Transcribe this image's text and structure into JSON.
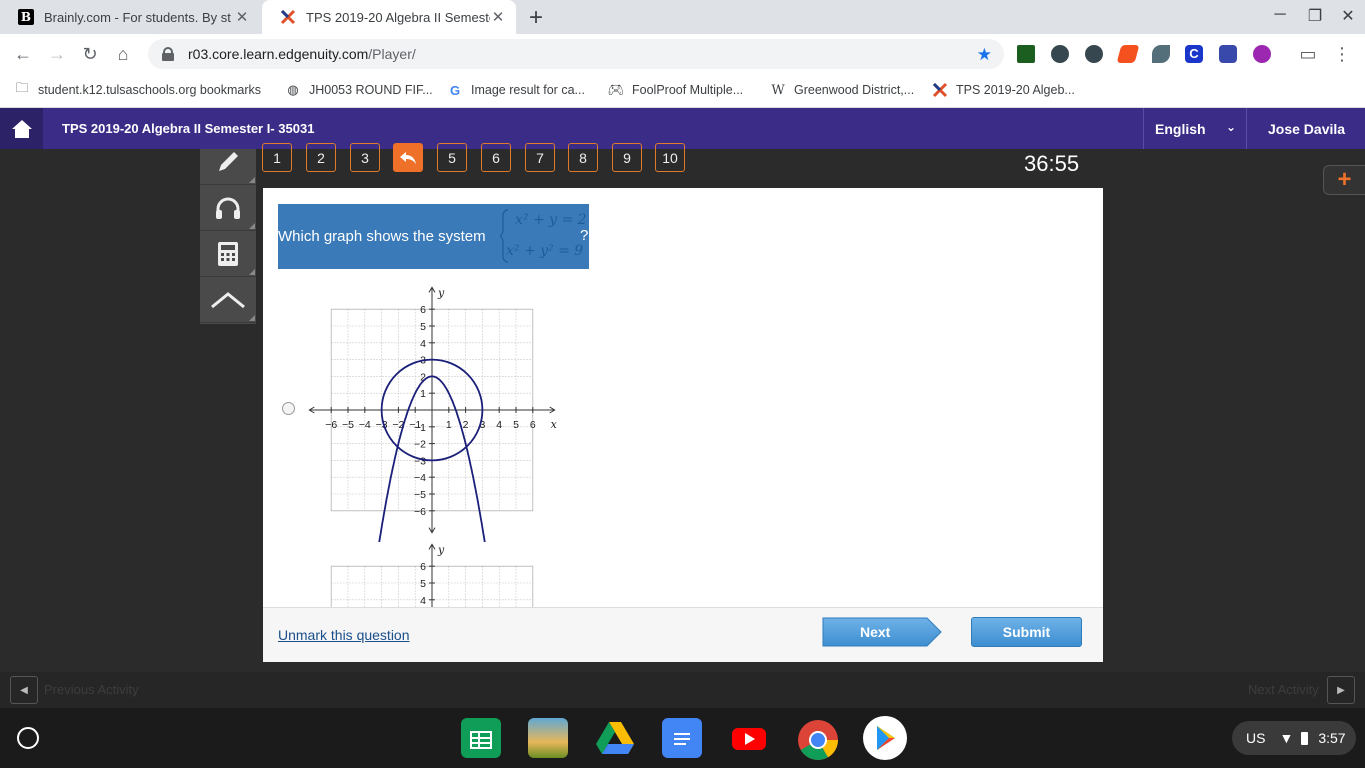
{
  "browser": {
    "tabs": [
      {
        "title": "Brainly.com - For students. By st",
        "favicon": "B"
      },
      {
        "title": "TPS 2019-20 Algebra II Semeste",
        "favicon": "edgenuity-x-icon"
      }
    ],
    "url": {
      "host": "r03.core.learn.edgenuity.com",
      "path": "/Player/"
    },
    "bookmarks": [
      "student.k12.tulsaschools.org bookmarks",
      "JH0053 ROUND FIF...",
      "Image result for ca...",
      "FoolProof Multiple...",
      "Greenwood District,...",
      "TPS 2019-20 Algeb..."
    ]
  },
  "app": {
    "course_title": "TPS 2019-20 Algebra II Semester I- 35031",
    "language": "English",
    "user": "Jose Davila",
    "timer": "36:55",
    "question_numbers": [
      "1",
      "2",
      "3",
      "4",
      "5",
      "6",
      "7",
      "8",
      "9",
      "10"
    ],
    "current_question_index": 3
  },
  "question": {
    "prompt": "Which graph shows the system",
    "system": {
      "eq1": "x² + y = 2",
      "eq2": "x² + y² = 9"
    },
    "end": "?"
  },
  "graph": {
    "x_label": "x",
    "y_label": "y",
    "x_ticks": [
      "−6",
      "−5",
      "−4",
      "−3",
      "−2",
      "−1",
      "1",
      "2",
      "3",
      "4",
      "5",
      "6"
    ],
    "y_ticks_pos": [
      "6",
      "5",
      "4",
      "3",
      "2",
      "1"
    ],
    "y_ticks_neg": [
      "−1",
      "−2",
      "−3",
      "−4",
      "−5",
      "−6"
    ],
    "curve_color": "#1a1f7a"
  },
  "footer": {
    "unmark": "Unmark this question",
    "next": "Next",
    "submit": "Submit"
  },
  "activity_bar": {
    "previous": "Previous Activity",
    "next": "Next Activity"
  },
  "system_tray": {
    "keyboard": "US",
    "time": "3:57"
  }
}
